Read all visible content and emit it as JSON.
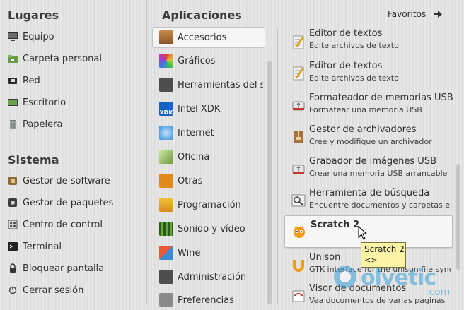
{
  "left": {
    "places_heading": "Lugares",
    "places": [
      {
        "label": "Equipo",
        "icon": "computer-icon"
      },
      {
        "label": "Carpeta personal",
        "icon": "home-folder-icon"
      },
      {
        "label": "Red",
        "icon": "network-icon"
      },
      {
        "label": "Escritorio",
        "icon": "desktop-icon"
      },
      {
        "label": "Papelera",
        "icon": "trash-icon"
      }
    ],
    "system_heading": "Sistema",
    "system": [
      {
        "label": "Gestor de software",
        "icon": "software-manager-icon"
      },
      {
        "label": "Gestor de paquetes",
        "icon": "package-manager-icon"
      },
      {
        "label": "Centro de control",
        "icon": "control-center-icon"
      },
      {
        "label": "Terminal",
        "icon": "terminal-icon"
      },
      {
        "label": "Bloquear pantalla",
        "icon": "lock-icon"
      },
      {
        "label": "Cerrar sesión",
        "icon": "logout-icon"
      }
    ]
  },
  "header": {
    "apps_heading": "Aplicaciones",
    "favorites_label": "Favoritos"
  },
  "categories": [
    {
      "label": "Accesorios",
      "icon": "accessories-icon",
      "color": "#b8733a",
      "selected": true
    },
    {
      "label": "Gráficos",
      "icon": "graphics-icon",
      "color": "#d9443a"
    },
    {
      "label": "Herramientas del s...",
      "icon": "system-tools-icon",
      "color": "#555555"
    },
    {
      "label": "Intel XDK",
      "icon": "intel-xdk-icon",
      "color": "#1565c0"
    },
    {
      "label": "Internet",
      "icon": "internet-icon",
      "color": "#3a8ed8"
    },
    {
      "label": "Oficina",
      "icon": "office-icon",
      "color": "#6d9a3c"
    },
    {
      "label": "Otras",
      "icon": "other-icon",
      "color": "#e08a1e"
    },
    {
      "label": "Programación",
      "icon": "programming-icon",
      "color": "#e0a21e"
    },
    {
      "label": "Sonido y vídeo",
      "icon": "sound-video-icon",
      "color": "#4a8a2a"
    },
    {
      "label": "Wine",
      "icon": "wine-icon",
      "color": "#8a3a3a"
    },
    {
      "label": "Administración",
      "icon": "administration-icon",
      "color": "#555555"
    },
    {
      "label": "Preferencias",
      "icon": "preferences-icon",
      "color": "#777777"
    }
  ],
  "apps": [
    {
      "title": "Editor de textos",
      "desc": "Edite archivos de texto",
      "icon": "text-editor-icon"
    },
    {
      "title": "Editor de textos",
      "desc": "Edite archivos de texto",
      "icon": "text-editor-icon"
    },
    {
      "title": "Formateador de memorias USB",
      "desc": "Formatear una memoria USB",
      "icon": "usb-formatter-icon"
    },
    {
      "title": "Gestor de archivadores",
      "desc": "Cree y modifique un archivador",
      "icon": "archive-manager-icon"
    },
    {
      "title": "Grabador de imágenes USB",
      "desc": "Crear una memoria USB arrancable",
      "icon": "usb-image-writer-icon"
    },
    {
      "title": "Herramienta de búsqueda",
      "desc": "Encuentre documentos y carpetas en e...",
      "icon": "search-tool-icon"
    },
    {
      "title": "Scratch 2",
      "desc": "",
      "icon": "scratch-icon",
      "hover": true
    },
    {
      "title": "Unison",
      "desc": "GTK interface for the unison file synchr...",
      "icon": "unison-icon"
    },
    {
      "title": "Visor de documentos",
      "desc": "Vea documentos de varias páginas",
      "icon": "document-viewer-icon"
    }
  ],
  "tooltip": {
    "title": "Scratch 2",
    "subtitle": "<>"
  },
  "watermark": {
    "brand": "olvetic",
    "suffix": ".com"
  }
}
